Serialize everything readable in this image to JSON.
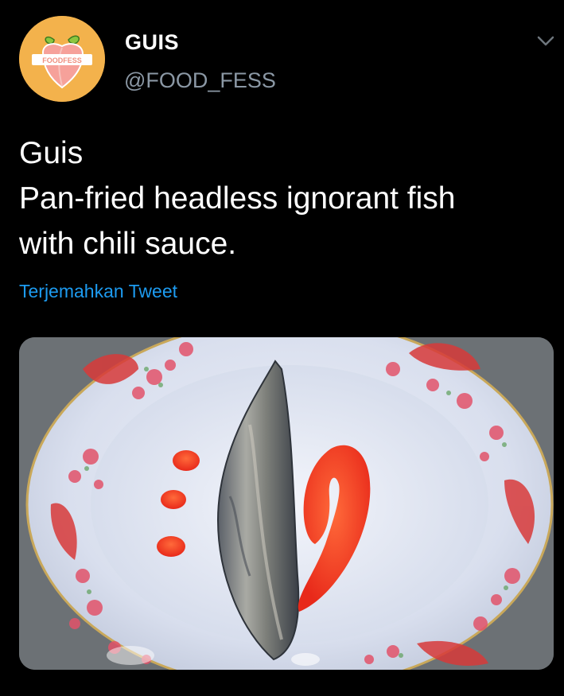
{
  "account": {
    "avatar_text": "FOODFESS",
    "display_name": "GUIS",
    "handle": "@FOOD_FESS"
  },
  "tweet": {
    "lines": [
      "Guis",
      "Pan-fried headless ignorant fish",
      "with chili sauce."
    ],
    "translate_label": "Terjemahkan Tweet"
  },
  "icons": {
    "menu": "chevron-down-icon"
  },
  "colors": {
    "background": "#000000",
    "link": "#1d9bf0",
    "handle": "#8b98a5",
    "avatar_bg": "#f3b24c"
  }
}
